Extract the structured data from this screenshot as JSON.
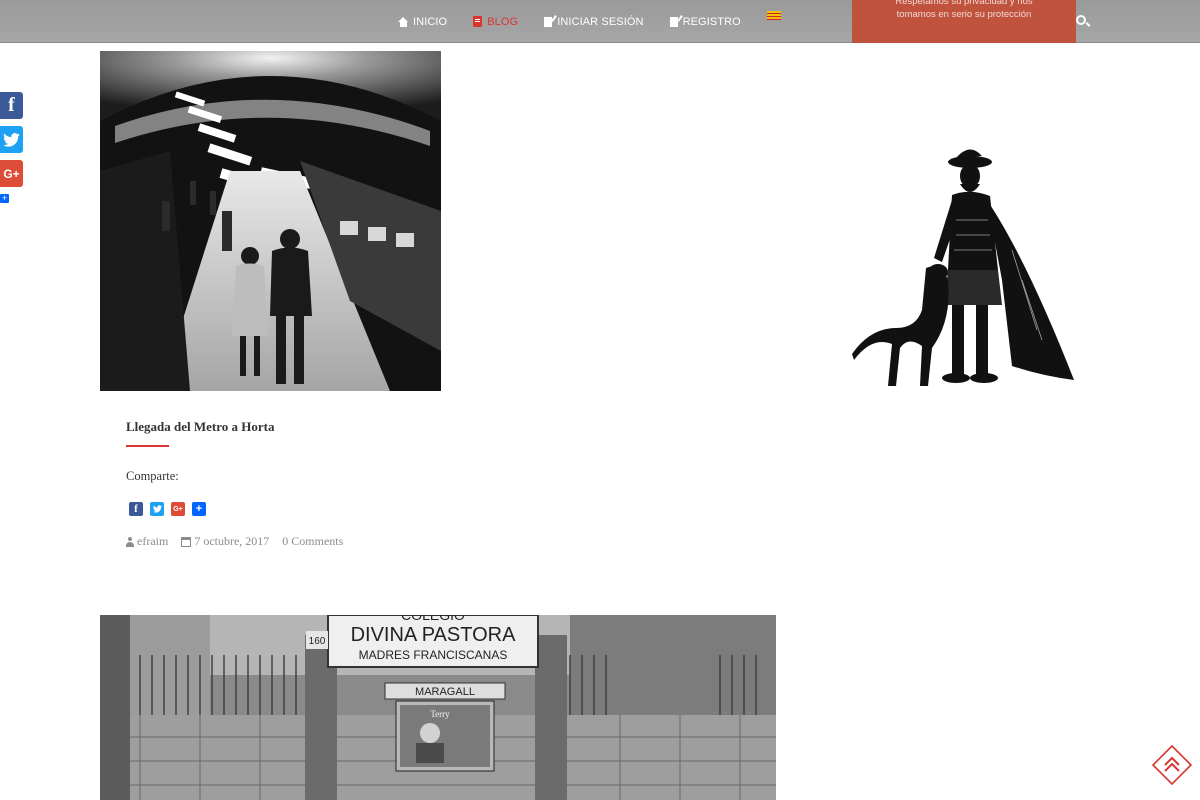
{
  "nav": {
    "items": [
      {
        "label": "Inicio",
        "icon": "home-icon",
        "active": false
      },
      {
        "label": "Blog",
        "icon": "book-icon",
        "active": true
      },
      {
        "label": "Iniciar sesión",
        "icon": "edit-icon",
        "active": false
      },
      {
        "label": "Registro",
        "icon": "edit-icon",
        "active": false
      }
    ],
    "language_flag": "catalan-flag-icon",
    "privacy_banner": {
      "line1": "Respetamos su privacidad y nos",
      "line2": "tomamos en serio su protección"
    },
    "search_icon": "search-icon"
  },
  "side_share": {
    "buttons": [
      "facebook-icon",
      "twitter-icon",
      "google-plus-icon",
      "addthis-plus-icon"
    ],
    "labels": {
      "facebook": "f",
      "twitter": "t",
      "google_plus": "G+",
      "plus": "+"
    }
  },
  "post1": {
    "title": "Llegada del Metro a Horta",
    "share_label": "Comparte:",
    "share_buttons": {
      "facebook": "f",
      "twitter": "t",
      "google_plus": "G+",
      "plus": "+"
    },
    "author": "efraim",
    "date": "7 octubre, 2017",
    "comments": "0 Comments"
  },
  "post2": {
    "image_text": {
      "sign_top": "COLEGIO",
      "sign_main": "DIVINA PASTORA",
      "sign_sub": "MADRES FRANCISCANAS",
      "sign_number": "160",
      "station": "MARAGALL",
      "poster": "Terry"
    }
  },
  "colors": {
    "accent": "#d9362f",
    "nav_bg": "#a0a0a0",
    "privacy_bg": "#c0533e",
    "facebook": "#3b5998",
    "twitter": "#1da1f2",
    "google_plus": "#dd4b39",
    "addthis": "#0166ff"
  }
}
